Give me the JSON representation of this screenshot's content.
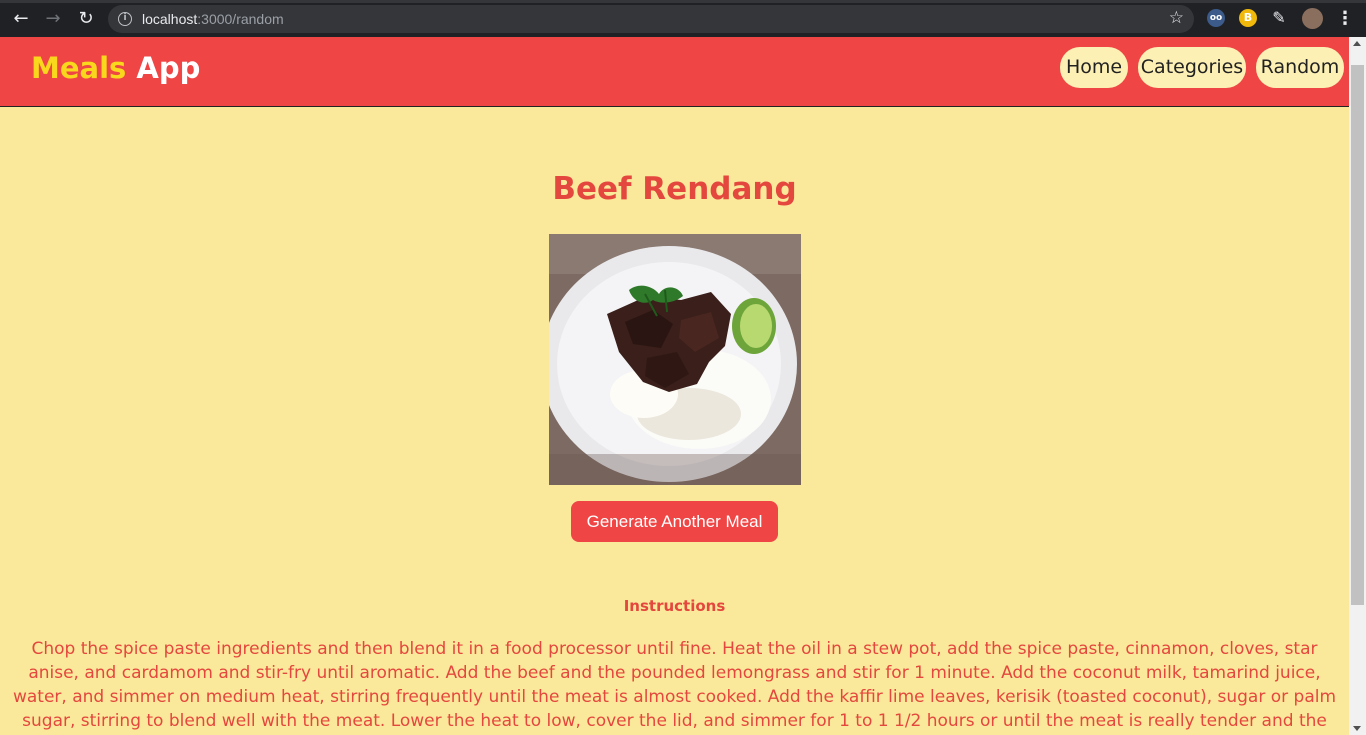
{
  "browser": {
    "url_host": "localhost",
    "url_rest": ":3000/random"
  },
  "header": {
    "logo_part1": "Meals",
    "logo_part2": "App",
    "nav": [
      "Home",
      "Categories",
      "Random"
    ]
  },
  "meal": {
    "title": "Beef Rendang",
    "button_label": "Generate Another Meal",
    "instructions_heading": "Instructions",
    "instructions": "Chop the spice paste ingredients and then blend it in a food processor until fine. Heat the oil in a stew pot, add the spice paste, cinnamon, cloves, star anise, and cardamom and stir-fry until aromatic. Add the beef and the pounded lemongrass and stir for 1 minute. Add the coconut milk, tamarind juice, water, and simmer on medium heat, stirring frequently until the meat is almost cooked. Add the kaffir lime leaves, kerisik (toasted coconut), sugar or palm sugar, stirring to blend well with the meat. Lower the heat to low, cover the lid, and simmer for 1 to 1 1/2 hours or until the meat is really tender and the gravy has dried up. Add more salt and sugar to"
  },
  "colors": {
    "page_bg": "#fbe99b",
    "navbar_bg": "#ef4545",
    "accent_text": "#e4473d",
    "logo_yellow": "#f9d71c"
  }
}
